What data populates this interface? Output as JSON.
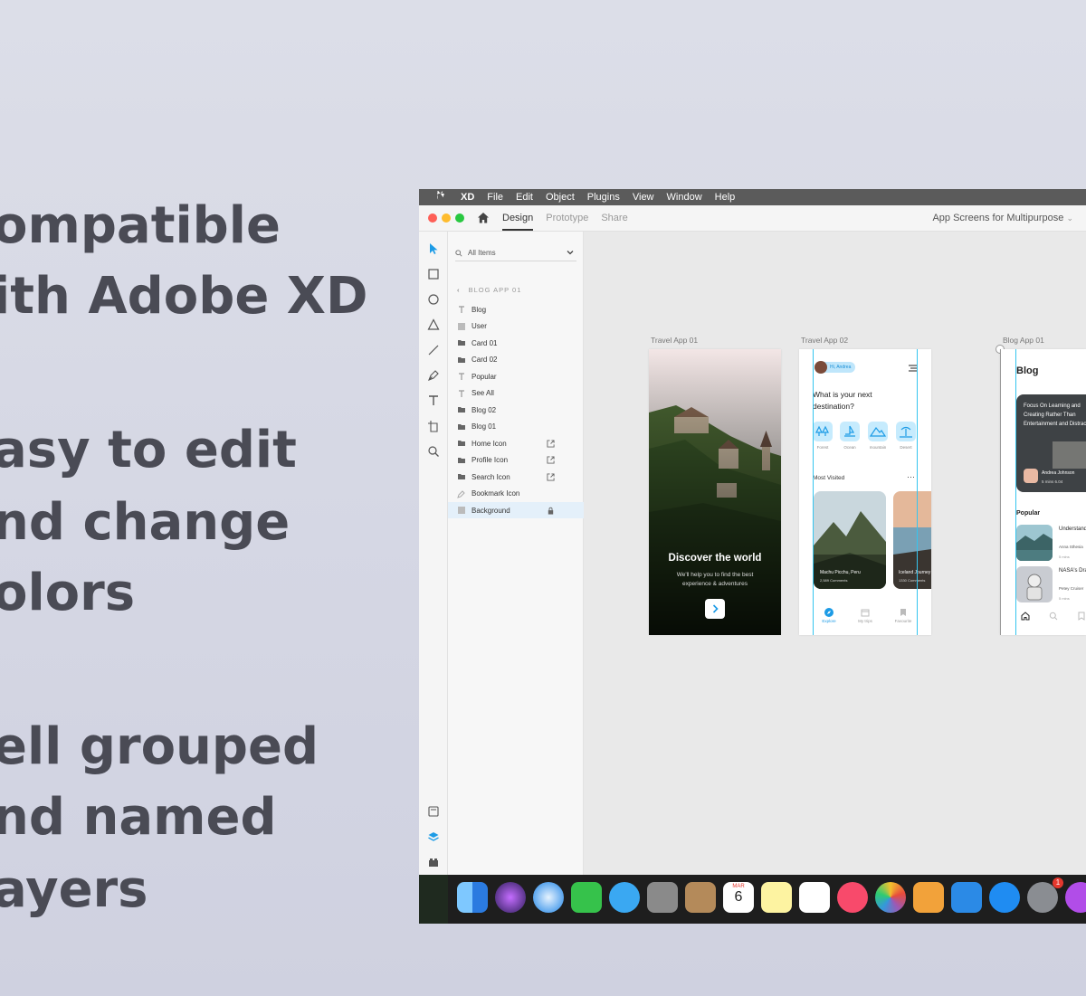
{
  "promo": {
    "lines": [
      "ompatible",
      "ith Adobe XD",
      "asy to edit",
      "nd change",
      "olors",
      "ell grouped",
      "nd named",
      "ayers"
    ]
  },
  "menubar": {
    "app": "XD",
    "items": [
      "File",
      "Edit",
      "Object",
      "Plugins",
      "View",
      "Window",
      "Help"
    ]
  },
  "titlebar": {
    "tabs": [
      "Design",
      "Prototype",
      "Share"
    ],
    "document": "App Screens for Multipurpose"
  },
  "layers": {
    "search_label": "All Items",
    "breadcrumb": "BLOG APP 01",
    "items": [
      {
        "label": "Blog",
        "kind": "text"
      },
      {
        "label": "User",
        "kind": "image"
      },
      {
        "label": "Card 01",
        "kind": "folder"
      },
      {
        "label": "Card 02",
        "kind": "folder"
      },
      {
        "label": "Popular",
        "kind": "text"
      },
      {
        "label": "See All",
        "kind": "text"
      },
      {
        "label": "Blog 02",
        "kind": "folder"
      },
      {
        "label": "Blog 01",
        "kind": "folder"
      },
      {
        "label": "Home Icon",
        "kind": "folder-link"
      },
      {
        "label": "Profile Icon",
        "kind": "folder-link"
      },
      {
        "label": "Search Icon",
        "kind": "folder-link"
      },
      {
        "label": "Bookmark Icon",
        "kind": "pen"
      },
      {
        "label": "Background",
        "kind": "image-locked"
      }
    ]
  },
  "artboards": {
    "travel1": {
      "label": "Travel App 01",
      "headline": "Discover the world",
      "sub1": "We'll help you to find the best",
      "sub2": "experience & adventures"
    },
    "travel2": {
      "label": "Travel App 02",
      "greeting": "Hi, Andrea",
      "question": "What is your next destination?",
      "categories": [
        "Forest",
        "Ocean",
        "mountain",
        "Desert"
      ],
      "most_visited": "Most Visited",
      "card1_title": "Machu Picchu, Peru",
      "card1_meta": "2,589 Comments",
      "card2_title": "Iceland Journey",
      "card2_meta": "1330 Comments",
      "nav": [
        "Explore",
        "My trips",
        "Favourite"
      ]
    },
    "blog": {
      "label": "Blog App 01",
      "title": "Blog",
      "card_text": "Focus On Learning and Creating Rather Than Entertainment and Distraction",
      "card_author": "Andrea Johnson",
      "card_meta": "5 mins    6.04",
      "popular": "Popular",
      "post1_title": "Understanding Climate Change",
      "post1_author": "Anna Sthesia",
      "post1_meta": "5 mins",
      "post2_title": "NASA's Dragon Mission To",
      "post2_author": "Petey Cruiser",
      "post2_meta": "5 mins"
    }
  },
  "dock": {
    "calendar_month": "MAR",
    "calendar_day": "6",
    "badge": "1"
  },
  "colors": {
    "accent": "#1c9be6",
    "guide": "#35c5ef",
    "menubar": "#5b5b5b",
    "promo_text": "#4a4b55"
  }
}
